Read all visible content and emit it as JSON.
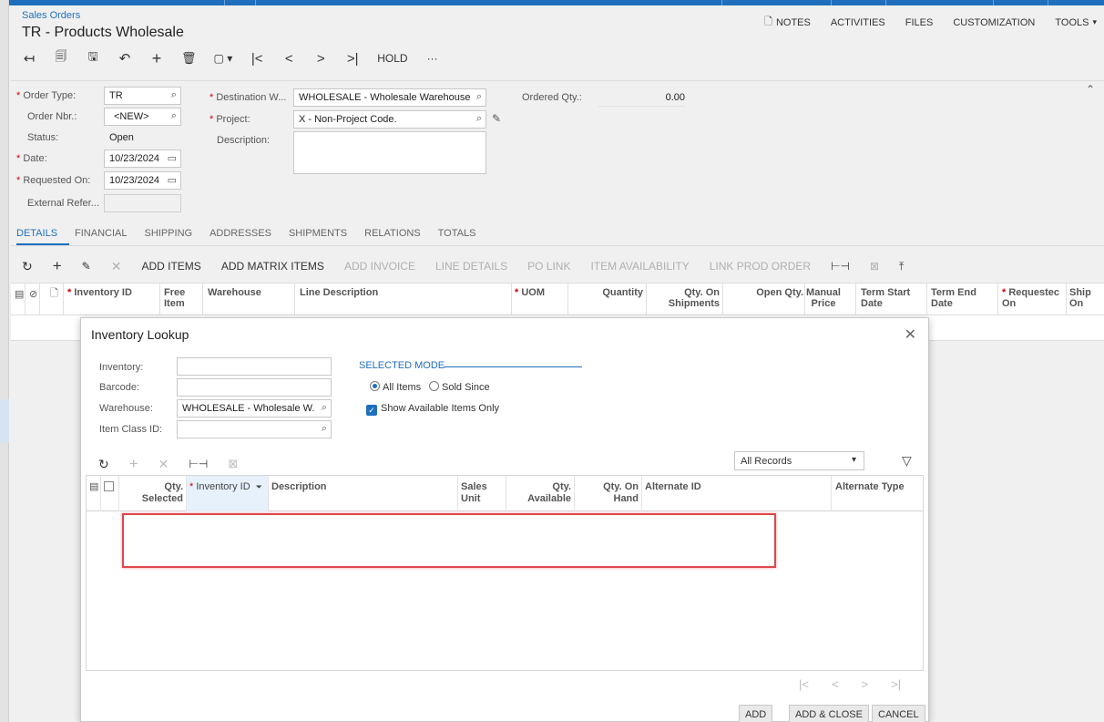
{
  "breadcrumb": "Sales Orders",
  "page_title": "TR - Products Wholesale",
  "top_links": [
    "NOTES",
    "ACTIVITIES",
    "FILES",
    "CUSTOMIZATION",
    "TOOLS"
  ],
  "toolbar": {
    "hold_label": "HOLD",
    "more_label": "···"
  },
  "form": {
    "order_type_label": "Order Type:",
    "order_type": "TR",
    "order_nbr_label": "Order Nbr.:",
    "order_nbr": "<NEW>",
    "status_label": "Status:",
    "status": "Open",
    "date_label": "Date:",
    "date": "10/23/2024",
    "requested_on_label": "Requested On:",
    "requested_on": "10/23/2024",
    "external_ref_label": "External Refer...",
    "external_ref": "",
    "destination_label": "Destination W...",
    "destination": "WHOLESALE - Wholesale Warehouse",
    "project_label": "Project:",
    "project": "X - Non-Project Code.",
    "description_label": "Description:",
    "description": "",
    "ordered_qty_label": "Ordered Qty.:",
    "ordered_qty": "0.00"
  },
  "tabs": [
    "DETAILS",
    "FINANCIAL",
    "SHIPPING",
    "ADDRESSES",
    "SHIPMENTS",
    "RELATIONS",
    "TOTALS"
  ],
  "grid_toolbar": {
    "add_items": "ADD ITEMS",
    "add_matrix_items": "ADD MATRIX ITEMS",
    "add_invoice": "ADD INVOICE",
    "line_details": "LINE DETAILS",
    "po_link": "PO LINK",
    "item_availability": "ITEM AVAILABILITY",
    "link_prod_order": "LINK PROD ORDER"
  },
  "grid_columns": {
    "inventory_id": "Inventory ID",
    "free_item": "Free Item",
    "warehouse": "Warehouse",
    "line_description": "Line Description",
    "uom": "UOM",
    "quantity": "Quantity",
    "qty_on_shipments": "Qty. On Shipments",
    "open_qty": "Open Qty.",
    "manual_price": "Manual Price",
    "term_start_date": "Term Start Date",
    "term_end_date": "Term End Date",
    "requested_on": "Requestec On",
    "ship_on": "Ship On"
  },
  "dialog": {
    "title": "Inventory Lookup",
    "inventory_label": "Inventory:",
    "inventory": "",
    "barcode_label": "Barcode:",
    "barcode": "",
    "warehouse_label": "Warehouse:",
    "warehouse": "WHOLESALE - Wholesale W.",
    "item_class_label": "Item Class ID:",
    "item_class": "",
    "selected_mode_label": "SELECTED MODE",
    "all_items_label": "All Items",
    "sold_since_label": "Sold Since",
    "show_available_label": "Show Available Items Only",
    "records_filter": "All Records",
    "columns": {
      "qty_selected": "Qty. Selected",
      "inventory_id": "Inventory ID",
      "description": "Description",
      "sales_unit": "Sales Unit",
      "qty_available": "Qty. Available",
      "qty_on_hand": "Qty. On Hand",
      "alternate_id": "Alternate ID",
      "alternate_type": "Alternate Type"
    },
    "buttons": {
      "add": "ADD",
      "add_close": "ADD & CLOSE",
      "cancel": "CANCEL"
    }
  },
  "colors": {
    "accent": "#1f6fbd",
    "highlight": "#e0474c"
  }
}
